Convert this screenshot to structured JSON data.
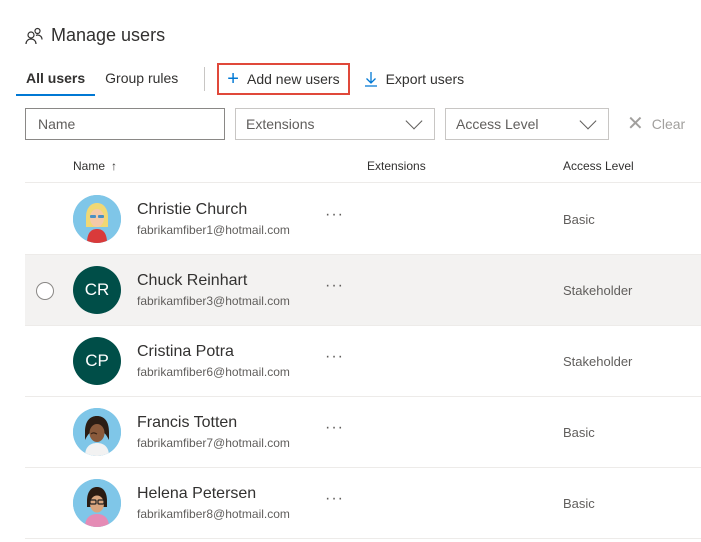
{
  "header": {
    "title": "Manage users",
    "icon": "users-icon"
  },
  "tabs": [
    {
      "label": "All users",
      "active": true
    },
    {
      "label": "Group rules",
      "active": false
    }
  ],
  "commands": {
    "add_new_users": "Add new users",
    "export_users": "Export users"
  },
  "filters": {
    "name_placeholder": "Name",
    "extensions": "Extensions",
    "access_level": "Access Level",
    "clear": "Clear"
  },
  "columns": {
    "name": "Name",
    "sort_indicator": "↑",
    "extensions": "Extensions",
    "access_level": "Access Level"
  },
  "users": [
    {
      "name": "Christie Church",
      "email": "fabrikamfiber1@hotmail.com",
      "access": "Basic",
      "initials": "",
      "more": "···"
    },
    {
      "name": "Chuck Reinhart",
      "email": "fabrikamfiber3@hotmail.com",
      "access": "Stakeholder",
      "initials": "CR",
      "more": "···"
    },
    {
      "name": "Cristina Potra",
      "email": "fabrikamfiber6@hotmail.com",
      "access": "Stakeholder",
      "initials": "CP",
      "more": "···"
    },
    {
      "name": "Francis Totten",
      "email": "fabrikamfiber7@hotmail.com",
      "access": "Basic",
      "initials": "",
      "more": "···"
    },
    {
      "name": "Helena Petersen",
      "email": "fabrikamfiber8@hotmail.com",
      "access": "Basic",
      "initials": "",
      "more": "···"
    }
  ],
  "colors": {
    "accent": "#0078d4",
    "highlight_border": "#e0483a",
    "initials_avatar": "#004e48"
  }
}
